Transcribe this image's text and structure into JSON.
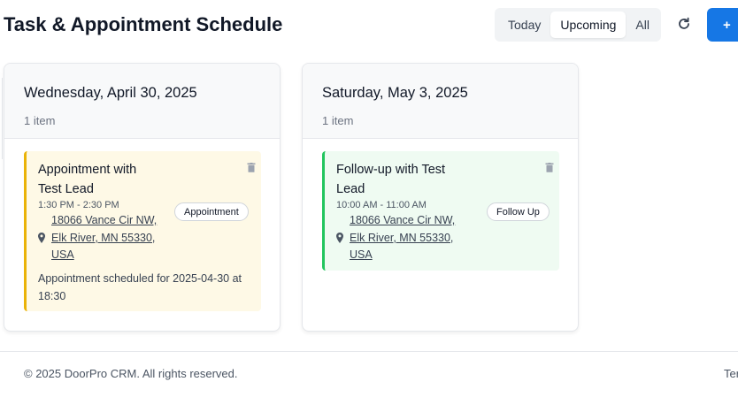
{
  "header": {
    "title": "Task & Appointment Schedule",
    "filters": [
      "Today",
      "Upcoming",
      "All"
    ],
    "active_filter": "Upcoming",
    "add_label": "+"
  },
  "icons": {
    "refresh": "refresh-icon",
    "add": "plus-icon",
    "location": "map-pin-icon",
    "delete": "trash-icon"
  },
  "colors": {
    "primary": "#1677e5",
    "appointment_accent": "#eab308",
    "appointment_bg": "#fef9e6",
    "followup_accent": "#22c55e",
    "followup_bg": "#effbf2"
  },
  "days": [
    {
      "title": "Wednesday, April 30, 2025",
      "count": "1 item",
      "item": {
        "title": "Appointment with Test Lead",
        "time": "1:30 PM - 2:30 PM",
        "address": "18066 Vance Cir NW, Elk River, MN 55330, USA",
        "badge": "Appointment",
        "notes": "Appointment scheduled for 2025-04-30 at 18:30"
      }
    },
    {
      "title": "Saturday, May 3, 2025",
      "count": "1 item",
      "item": {
        "title": "Follow-up with Test Lead",
        "time": "10:00 AM - 11:00 AM",
        "address": "18066 Vance Cir NW, Elk River, MN 55330, USA",
        "badge": "Follow Up"
      }
    }
  ],
  "footer": {
    "copyright": "© 2025 DoorPro CRM. All rights reserved.",
    "link": "Ter"
  }
}
